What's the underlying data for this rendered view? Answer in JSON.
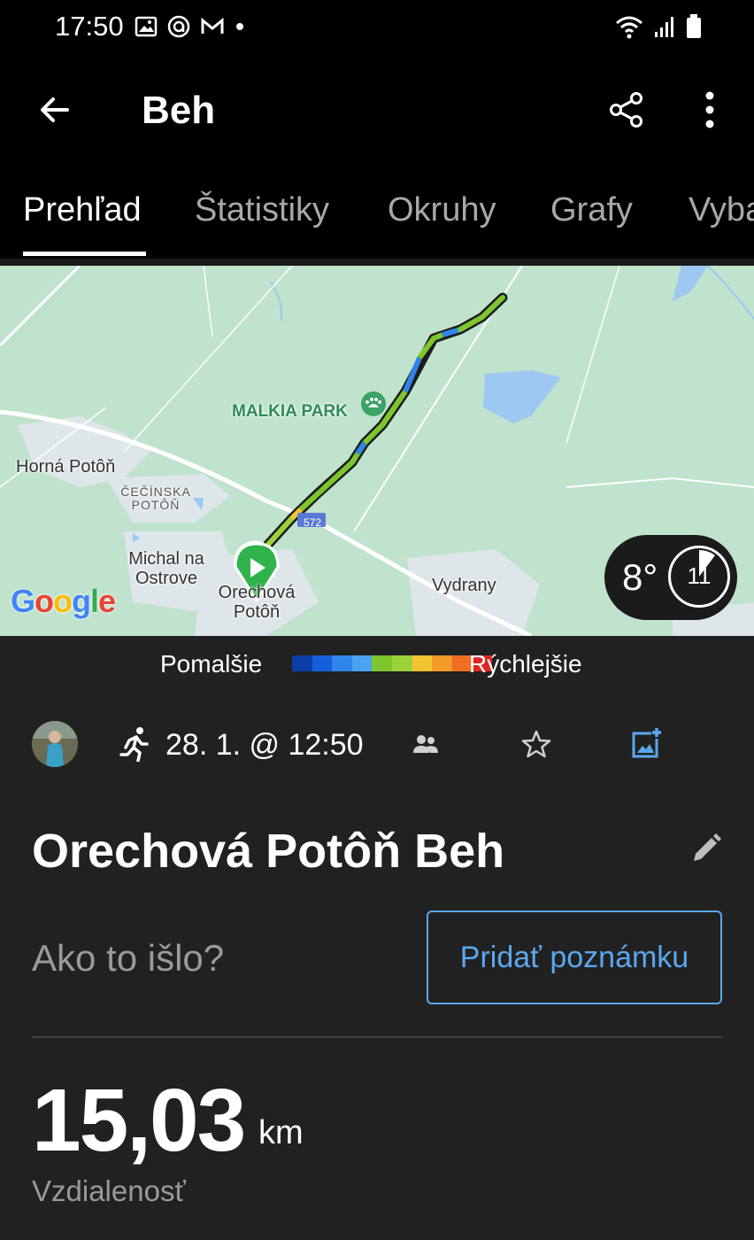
{
  "status_bar": {
    "time": "17:50",
    "left_icons": [
      "image-icon",
      "threads-icon",
      "gmail-icon",
      "dot-icon"
    ],
    "right_icons": [
      "wifi-icon",
      "signal-icon",
      "battery-icon"
    ]
  },
  "app_bar": {
    "title": "Beh",
    "back_icon": "arrow-left-icon",
    "share_icon": "share-icon",
    "more_icon": "more-vertical-icon"
  },
  "tabs": [
    {
      "label": "Prehľad",
      "active": true
    },
    {
      "label": "Štatistiky",
      "active": false
    },
    {
      "label": "Okruhy",
      "active": false
    },
    {
      "label": "Grafy",
      "active": false
    },
    {
      "label": "Vyba",
      "active": false
    }
  ],
  "map": {
    "labels": {
      "horna": "Horná Potôň",
      "cecinska": "ČEČÍNSKA POTÔŇ",
      "michal": "Michal na Ostrove",
      "orechova": "Orechová Potôň",
      "vydrany": "Vydrany",
      "malkia": "MALKIA PARK",
      "road": "572"
    },
    "google_logo": "Google",
    "weather": {
      "temperature": "8°",
      "hour": "11"
    }
  },
  "legend": {
    "slow_label": "Pomalšie",
    "fast_label": "Rýchlejšie",
    "colors": [
      "#0b3fa6",
      "#1560d8",
      "#2f86ea",
      "#4aa3f0",
      "#7dc62e",
      "#9bd23a",
      "#f3c431",
      "#f39a2b",
      "#ef6e22",
      "#e02424"
    ]
  },
  "activity": {
    "date": "28. 1. @ 12:50",
    "title": "Orechová Potôň Beh",
    "how_prompt": "Ako to išlo?",
    "add_note_label": "Pridať poznámku",
    "distance_value": "15,03",
    "distance_unit": "km",
    "distance_label": "Vzdialenosť"
  }
}
